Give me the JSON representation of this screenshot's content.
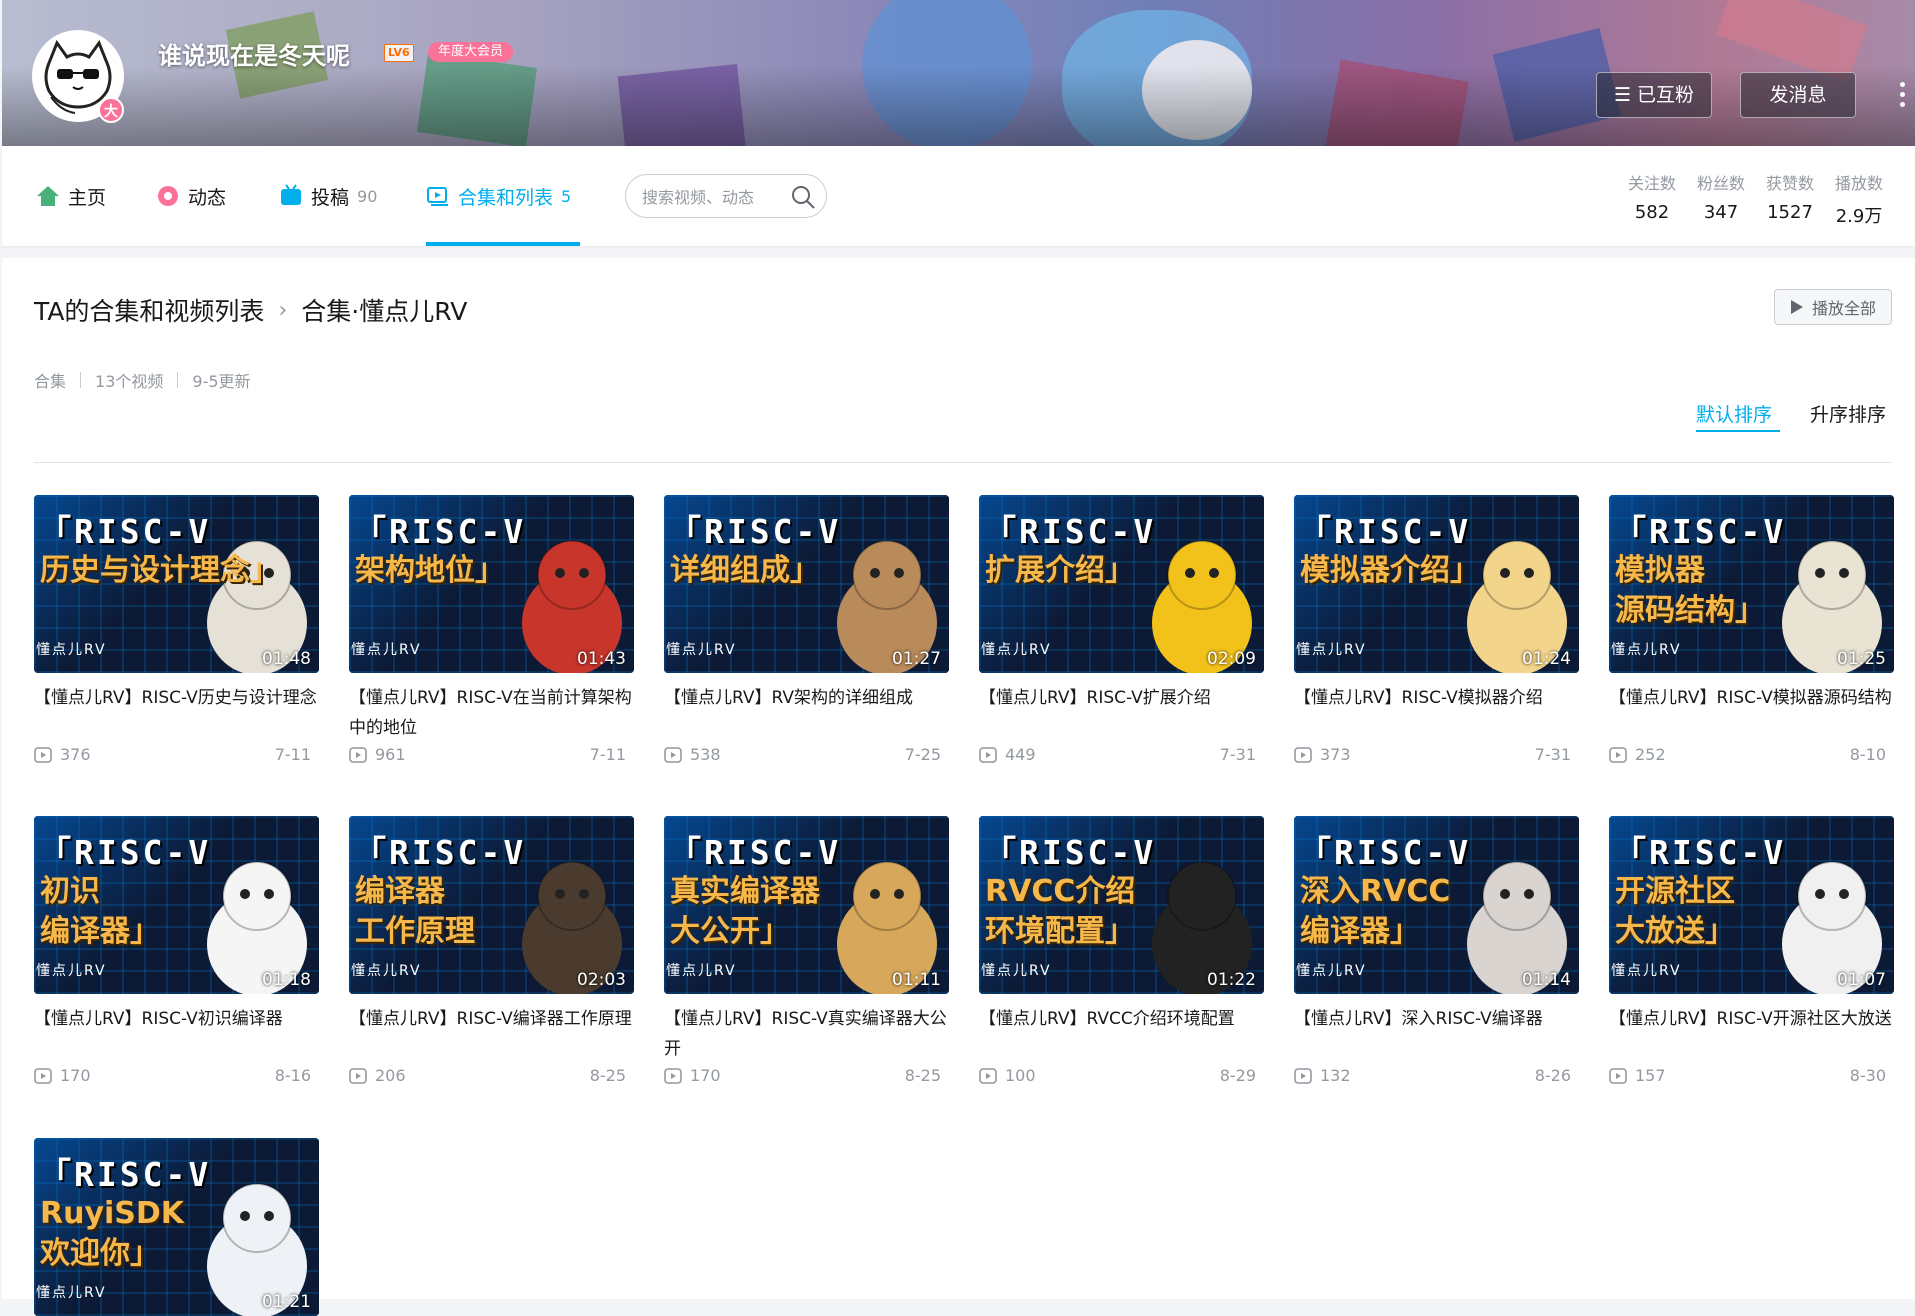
{
  "user": {
    "name": "谁说现在是冬天呢",
    "level": "LV6",
    "vip_label": "年度大会员",
    "avatar_badge": "大"
  },
  "actions": {
    "follow_label": "已互粉",
    "message_label": "发消息"
  },
  "nav": {
    "items": [
      {
        "label": "主页",
        "icon": "home-icon",
        "count": ""
      },
      {
        "label": "动态",
        "icon": "dynamic-icon",
        "count": ""
      },
      {
        "label": "投稿",
        "icon": "upload-icon",
        "count": "90"
      },
      {
        "label": "合集和列表",
        "icon": "collection-icon",
        "count": "5"
      }
    ],
    "active": "合集和列表",
    "search_placeholder": "搜索视频、动态"
  },
  "stats": [
    {
      "label": "关注数",
      "value": "582"
    },
    {
      "label": "粉丝数",
      "value": "347"
    },
    {
      "label": "获赞数",
      "value": "1527"
    },
    {
      "label": "播放数",
      "value": "2.9万"
    }
  ],
  "collection": {
    "breadcrumb_root": "TA的合集和视频列表",
    "breadcrumb_current": "合集·懂点儿RV",
    "play_all": "播放全部",
    "meta": [
      "合集",
      "13个视频",
      "9-5更新"
    ],
    "sort_default": "默认排序",
    "sort_asc": "升序排序"
  },
  "thumb_brand": "懂点儿RV",
  "videos": [
    {
      "thumb_main": "「RISC-V",
      "thumb_sub": "历史与设计理念」",
      "duration": "01:48",
      "title": "【懂点儿RV】RISC-V历史与设计理念",
      "plays": "376",
      "date": "7-11"
    },
    {
      "thumb_main": "「RISC-V",
      "thumb_sub": "架构地位」",
      "duration": "01:43",
      "title": "【懂点儿RV】RISC-V在当前计算架构中的地位",
      "plays": "961",
      "date": "7-11"
    },
    {
      "thumb_main": "「RISC-V",
      "thumb_sub": "详细组成」",
      "duration": "01:27",
      "title": "【懂点儿RV】RV架构的详细组成",
      "plays": "538",
      "date": "7-25"
    },
    {
      "thumb_main": "「RISC-V",
      "thumb_sub": "扩展介绍」",
      "duration": "02:09",
      "title": "【懂点儿RV】RISC-V扩展介绍",
      "plays": "449",
      "date": "7-31"
    },
    {
      "thumb_main": "「RISC-V",
      "thumb_sub": "模拟器介绍」",
      "duration": "01:24",
      "title": "【懂点儿RV】RISC-V模拟器介绍",
      "plays": "373",
      "date": "7-31"
    },
    {
      "thumb_main": "「RISC-V",
      "thumb_sub": "模拟器\n源码结构」",
      "duration": "01:25",
      "title": "【懂点儿RV】RISC-V模拟器源码结构",
      "plays": "252",
      "date": "8-10"
    },
    {
      "thumb_main": "「RISC-V",
      "thumb_sub": "初识\n编译器」",
      "duration": "01:18",
      "title": "【懂点儿RV】RISC-V初识编译器",
      "plays": "170",
      "date": "8-16"
    },
    {
      "thumb_main": "「RISC-V",
      "thumb_sub": "编译器\n工作原理",
      "duration": "02:03",
      "title": "【懂点儿RV】RISC-V编译器工作原理",
      "plays": "206",
      "date": "8-25"
    },
    {
      "thumb_main": "「RISC-V",
      "thumb_sub": "真实编译器\n大公开」",
      "duration": "01:11",
      "title": "【懂点儿RV】RISC-V真实编译器大公开",
      "plays": "170",
      "date": "8-25"
    },
    {
      "thumb_main": "「RISC-V",
      "thumb_sub": "RVCC介绍\n环境配置」",
      "duration": "01:22",
      "title": "【懂点儿RV】RVCC介绍环境配置",
      "plays": "100",
      "date": "8-29"
    },
    {
      "thumb_main": "「RISC-V",
      "thumb_sub": "深入RVCC\n编译器」",
      "duration": "01:14",
      "title": "【懂点儿RV】深入RISC-V编译器",
      "plays": "132",
      "date": "8-26"
    },
    {
      "thumb_main": "「RISC-V",
      "thumb_sub": "开源社区\n大放送」",
      "duration": "01:07",
      "title": "【懂点儿RV】RISC-V开源社区大放送",
      "plays": "157",
      "date": "8-30"
    },
    {
      "thumb_main": "「RISC-V",
      "thumb_sub": "RuyiSDK\n欢迎你」",
      "duration": "01:21",
      "title": "",
      "plays": "",
      "date": ""
    }
  ],
  "colors": {
    "accent": "#00aeec",
    "vip_pink": "#fb7299",
    "level_orange": "#ff6c00",
    "thumb_title_orange": "#f6b84b"
  }
}
